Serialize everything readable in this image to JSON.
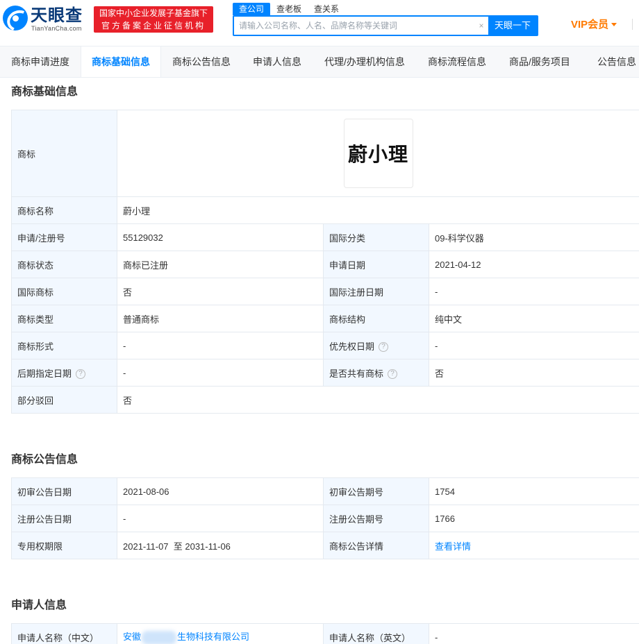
{
  "header": {
    "logo_text": "天眼查",
    "logo_sub": "TianYanCha.com",
    "badge_line1": "国家中小企业发展子基金旗下",
    "badge_line2": "官方备案企业征信机构",
    "search_tabs": [
      "查公司",
      "查老板",
      "查关系"
    ],
    "search_placeholder": "请输入公司名称、人名、品牌名称等关键词",
    "clear_glyph": "×",
    "search_button": "天眼一下",
    "vip_label": "VIP会员"
  },
  "nav": {
    "items": [
      "商标申请进度",
      "商标基础信息",
      "商标公告信息",
      "申请人信息",
      "代理/办理机构信息",
      "商标流程信息",
      "商品/服务项目",
      "公告信息"
    ],
    "active_index": 1
  },
  "basic": {
    "title": "商标基础信息",
    "trademark_label": "商标",
    "trademark_image_text": "蔚小理",
    "rows": {
      "name_label": "商标名称",
      "name_value": "蔚小理",
      "reg_no_label": "申请/注册号",
      "reg_no_value": "55129032",
      "intl_class_label": "国际分类",
      "intl_class_value": "09-科学仪器",
      "status_label": "商标状态",
      "status_value": "商标已注册",
      "apply_date_label": "申请日期",
      "apply_date_value": "2021-04-12",
      "intl_tm_label": "国际商标",
      "intl_tm_value": "否",
      "intl_reg_date_label": "国际注册日期",
      "intl_reg_date_value": "-",
      "type_label": "商标类型",
      "type_value": "普通商标",
      "structure_label": "商标结构",
      "structure_value": "纯中文",
      "form_label": "商标形式",
      "form_value": "-",
      "priority_label": "优先权日期",
      "priority_value": "-",
      "later_date_label": "后期指定日期",
      "later_date_value": "-",
      "shared_label": "是否共有商标",
      "shared_value": "否",
      "partial_label": "部分驳回",
      "partial_value": "否"
    },
    "help_glyph": "?"
  },
  "announcement": {
    "title": "商标公告信息",
    "prelim_date_label": "初审公告日期",
    "prelim_date_value": "2021-08-06",
    "prelim_no_label": "初审公告期号",
    "prelim_no_value": "1754",
    "reg_date_label": "注册公告日期",
    "reg_date_value": "-",
    "reg_no_label": "注册公告期号",
    "reg_no_value": "1766",
    "term_label": "专用权期限",
    "term_value": "2021-11-07  至 2031-11-06",
    "detail_label": "商标公告详情",
    "detail_link": "查看详情"
  },
  "applicant": {
    "title": "申请人信息",
    "cn_name_label": "申请人名称（中文）",
    "cn_name_prefix": "安徽",
    "cn_name_suffix": "生物科技有限公司",
    "en_name_label": "申请人名称（英文）",
    "en_name_value": "-"
  }
}
